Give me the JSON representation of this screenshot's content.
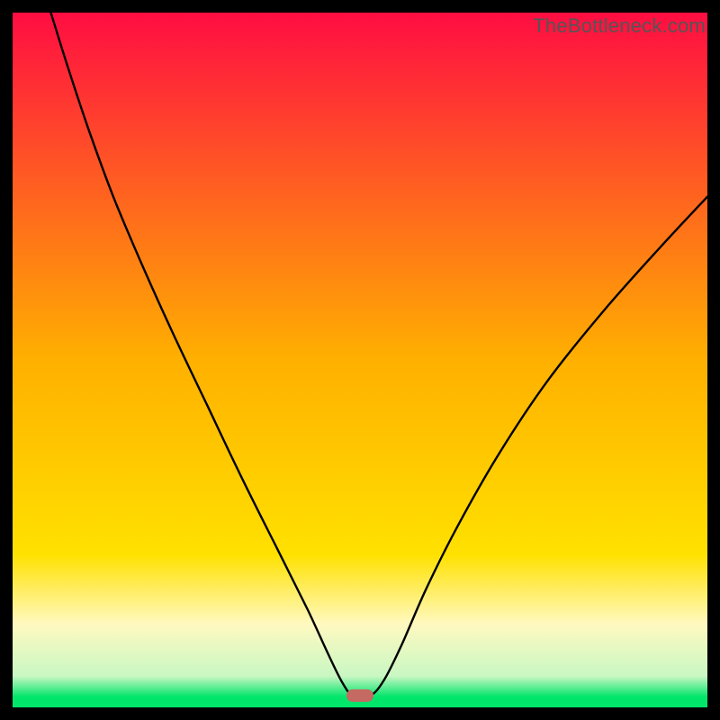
{
  "watermark": "TheBottleneck.com",
  "chart_data": {
    "type": "line",
    "title": "",
    "xlabel": "",
    "ylabel": "",
    "xlim": [
      0,
      100
    ],
    "ylim": [
      0,
      100
    ],
    "grid": false,
    "legend": false,
    "note": "No axis ticks or numeric labels are visible in the image; x/y values below are estimated from pixel positions on a 0–100 normalized scale.",
    "background_gradient": {
      "type": "vertical",
      "stops": [
        {
          "pos": 0.0,
          "color": "#ff0d42"
        },
        {
          "pos": 0.5,
          "color": "#ffb000"
        },
        {
          "pos": 0.78,
          "color": "#ffe100"
        },
        {
          "pos": 0.88,
          "color": "#fff9c0"
        },
        {
          "pos": 0.955,
          "color": "#c9f7c3"
        },
        {
          "pos": 0.985,
          "color": "#00e56a"
        },
        {
          "pos": 1.0,
          "color": "#00e56a"
        }
      ]
    },
    "marker": {
      "shape": "pill",
      "x": 50,
      "y": 1.7,
      "color": "#c46a63"
    },
    "series": [
      {
        "name": "curve",
        "color": "#000000",
        "x": [
          5.5,
          8.0,
          11.0,
          14.5,
          18.5,
          23.0,
          28.0,
          33.0,
          38.0,
          42.5,
          45.5,
          47.5,
          49.0,
          51.5,
          53.5,
          56.0,
          59.5,
          64.0,
          70.0,
          77.0,
          85.0,
          93.0,
          100.0
        ],
        "y": [
          100.0,
          92.0,
          83.0,
          73.5,
          64.0,
          54.0,
          43.5,
          33.0,
          23.0,
          14.0,
          7.5,
          3.5,
          1.7,
          1.7,
          4.0,
          9.0,
          17.0,
          26.0,
          36.5,
          47.0,
          57.0,
          66.0,
          73.5
        ]
      }
    ]
  }
}
